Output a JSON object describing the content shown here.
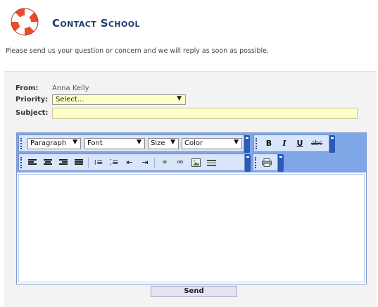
{
  "header": {
    "title": "Contact School",
    "logo_icon": "lifebuoy-icon"
  },
  "intro": "Please send us your question or concern and we will reply as soon as possible.",
  "form": {
    "from_label": "From:",
    "from_value": "Anna Kelly",
    "priority_label": "Priority:",
    "priority_selected": "Select...",
    "subject_label": "Subject:",
    "subject_value": ""
  },
  "editor": {
    "format_dropdown": "Paragraph",
    "font_dropdown": "Font",
    "size_dropdown": "Size",
    "color_dropdown": "Color",
    "bold": "B",
    "italic": "I",
    "underline": "U",
    "strikethrough": "abc"
  },
  "colors": {
    "field_bg": "#ffffc8",
    "toolbar_bg": "#7fa7e8",
    "title": "#1d3c6e"
  },
  "send_label": "Send"
}
